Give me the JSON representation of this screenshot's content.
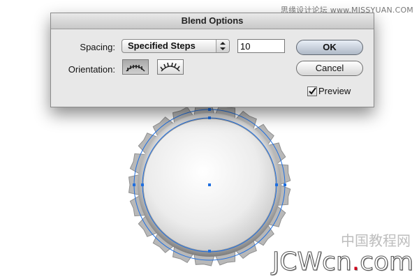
{
  "watermark": {
    "top": "思缘设计论坛 www.MISSYUAN.COM",
    "bottom_cn": "中国教程网",
    "bottom_en_part1": "JCWcn",
    "bottom_en_dot": ".",
    "bottom_en_part2": "com"
  },
  "dialog": {
    "title": "Blend Options",
    "spacing_label": "Spacing:",
    "spacing_value": "Specified Steps",
    "steps_value": "10",
    "orientation_label": "Orientation:",
    "orientation_selected": "align-to-page",
    "ok_label": "OK",
    "cancel_label": "Cancel",
    "preview_label": "Preview",
    "preview_checked": true
  },
  "artwork": {
    "object": "bottle-cap",
    "selection_color": "#1f6fe0"
  }
}
